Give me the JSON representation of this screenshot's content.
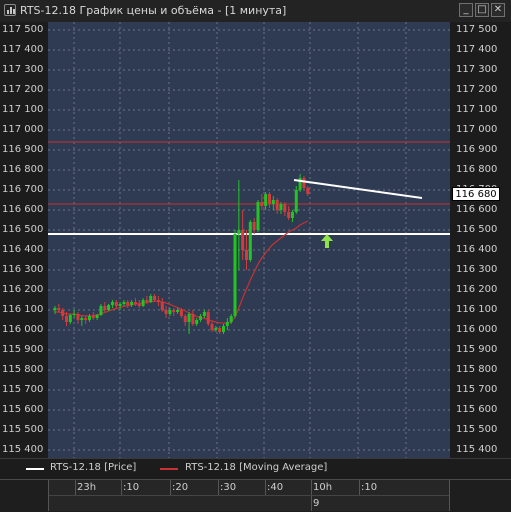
{
  "window": {
    "title": "RTS-12.18 График цены и объёма - [1 минута]",
    "controls": {
      "minimize": "_",
      "maximize": "□",
      "close": "✕"
    }
  },
  "colors": {
    "plot_background": "#2e3b53",
    "grid": "#8a8f99",
    "up_candle": "#22c322",
    "down_candle": "#d23c3c",
    "ma_line": "#c83232",
    "support_line": "#ffffff",
    "red_level": "#c83232",
    "arrow": "#8fe34a"
  },
  "axes": {
    "y_ticks": [
      "117 500",
      "117 400",
      "117 300",
      "117 200",
      "117 100",
      "117 000",
      "116 900",
      "116 800",
      "116 700",
      "116 600",
      "116 500",
      "116 400",
      "116 300",
      "116 200",
      "116 100",
      "116 000",
      "115 900",
      "115 800",
      "115 700",
      "115 600",
      "115 500",
      "115 400"
    ],
    "current_price": "116 680"
  },
  "legend": [
    {
      "label": "RTS-12.18 [Price]",
      "color": "#ffffff"
    },
    {
      "label": "RTS-12.18 [Moving Average]",
      "color": "#c83232"
    }
  ],
  "time_axis": {
    "labels": [
      "23h",
      ":10",
      ":20",
      ":30",
      ":40",
      "10h",
      ":10"
    ],
    "day_label": "9"
  },
  "chart_data": {
    "type": "candlestick",
    "ylim": [
      115400,
      117500
    ],
    "grid": true,
    "horizontal_levels": [
      {
        "price": 116940,
        "style": "red"
      },
      {
        "price": 116630,
        "style": "red"
      },
      {
        "price": 116480,
        "style": "white-thick"
      }
    ],
    "trendline": {
      "from": [
        0,
        116750
      ],
      "to": [
        1,
        116660
      ]
    },
    "candles": [
      [
        116100,
        116120,
        116080,
        116110
      ],
      [
        116110,
        116130,
        116090,
        116100
      ],
      [
        116100,
        116110,
        116050,
        116070
      ],
      [
        116070,
        116090,
        116020,
        116040
      ],
      [
        116040,
        116080,
        116030,
        116075
      ],
      [
        116075,
        116100,
        116060,
        116080
      ],
      [
        116080,
        116090,
        116030,
        116050
      ],
      [
        116050,
        116070,
        116020,
        116060
      ],
      [
        116060,
        116070,
        116030,
        116050
      ],
      [
        116050,
        116080,
        116040,
        116070
      ],
      [
        116070,
        116090,
        116050,
        116060
      ],
      [
        116060,
        116080,
        116050,
        116075
      ],
      [
        116075,
        116130,
        116070,
        116120
      ],
      [
        116120,
        116140,
        116090,
        116100
      ],
      [
        116100,
        116130,
        116095,
        116125
      ],
      [
        116125,
        116150,
        116110,
        116140
      ],
      [
        116140,
        116150,
        116110,
        116120
      ],
      [
        116120,
        116140,
        116100,
        116130
      ],
      [
        116130,
        116150,
        116120,
        116140
      ],
      [
        116140,
        116150,
        116110,
        116125
      ],
      [
        116125,
        116150,
        116115,
        116140
      ],
      [
        116140,
        116160,
        116120,
        116130
      ],
      [
        116130,
        116150,
        116110,
        116120
      ],
      [
        116120,
        116160,
        116115,
        116150
      ],
      [
        116150,
        116170,
        116130,
        116140
      ],
      [
        116140,
        116180,
        116135,
        116170
      ],
      [
        116170,
        116180,
        116140,
        116150
      ],
      [
        116150,
        116170,
        116120,
        116140
      ],
      [
        116140,
        116160,
        116090,
        116100
      ],
      [
        116100,
        116120,
        116060,
        116080
      ],
      [
        116080,
        116110,
        116070,
        116100
      ],
      [
        116100,
        116110,
        116070,
        116090
      ],
      [
        116090,
        116110,
        116080,
        116100
      ],
      [
        116100,
        116110,
        116060,
        116070
      ],
      [
        116070,
        116080,
        116020,
        116040
      ],
      [
        116040,
        116090,
        115980,
        116080
      ],
      [
        116080,
        116100,
        116020,
        116030
      ],
      [
        116030,
        116060,
        116020,
        116050
      ],
      [
        116050,
        116080,
        116040,
        116070
      ],
      [
        116070,
        116100,
        116060,
        116090
      ],
      [
        116090,
        116100,
        116020,
        116030
      ],
      [
        116030,
        116040,
        115990,
        116000
      ],
      [
        116000,
        116020,
        115990,
        116010
      ],
      [
        116010,
        116020,
        115980,
        115990
      ],
      [
        115990,
        116030,
        115980,
        116020
      ],
      [
        116020,
        116060,
        116000,
        116040
      ],
      [
        116040,
        116080,
        116030,
        116070
      ],
      [
        116070,
        116500,
        116060,
        116480
      ],
      [
        116480,
        116750,
        116300,
        116500
      ],
      [
        116500,
        116600,
        116350,
        116400
      ],
      [
        116400,
        116500,
        116300,
        116350
      ],
      [
        116350,
        116550,
        116340,
        116540
      ],
      [
        116540,
        116560,
        116480,
        116500
      ],
      [
        116500,
        116650,
        116490,
        116640
      ],
      [
        116640,
        116680,
        116600,
        116620
      ],
      [
        116620,
        116690,
        116600,
        116680
      ],
      [
        116680,
        116690,
        116610,
        116630
      ],
      [
        116630,
        116670,
        116600,
        116650
      ],
      [
        116650,
        116660,
        116580,
        116600
      ],
      [
        116600,
        116640,
        116580,
        116630
      ],
      [
        116630,
        116640,
        116570,
        116590
      ],
      [
        116590,
        116620,
        116550,
        116560
      ],
      [
        116560,
        116600,
        116540,
        116590
      ],
      [
        116590,
        116720,
        116580,
        116700
      ],
      [
        116700,
        116780,
        116690,
        116760
      ],
      [
        116760,
        116770,
        116700,
        116710
      ],
      [
        116710,
        116720,
        116670,
        116680
      ]
    ],
    "moving_average": [
      116090,
      116090,
      116085,
      116080,
      116080,
      116080,
      116075,
      116072,
      116070,
      116070,
      116072,
      116075,
      116082,
      116088,
      116095,
      116102,
      116108,
      116112,
      116118,
      116122,
      116126,
      116130,
      116132,
      116135,
      116138,
      116142,
      116144,
      116144,
      116140,
      116135,
      116128,
      116120,
      116112,
      116104,
      116095,
      116085,
      116076,
      116068,
      116062,
      116058,
      116052,
      116045,
      116040,
      116036,
      116034,
      116035,
      116040,
      116065,
      116110,
      116160,
      116205,
      116250,
      116290,
      116330,
      116360,
      116385,
      116410,
      116430,
      116445,
      116460,
      116475,
      116490,
      116500,
      116510,
      116525,
      116535,
      116545
    ]
  }
}
